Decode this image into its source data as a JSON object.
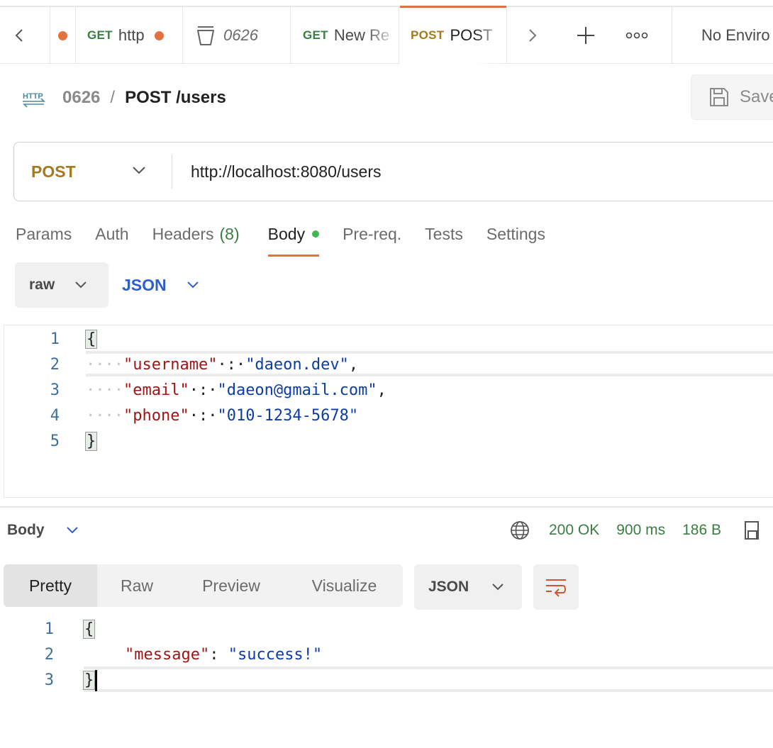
{
  "tabs": [
    {
      "method": "",
      "name": "",
      "dot": true
    },
    {
      "method": "GET",
      "name": "http",
      "dot": true
    },
    {
      "method": "",
      "name": "0626",
      "icon": "collection-icon"
    },
    {
      "method": "GET",
      "name": "New Re"
    },
    {
      "method": "POST",
      "name": "POST",
      "active": true
    }
  ],
  "environment": "No Enviro",
  "breadcrumb": {
    "parent": "0626",
    "separator": "/",
    "title": "POST /users",
    "protocol_icon_text": "HTTP"
  },
  "save_label": "Save",
  "request": {
    "method": "POST",
    "url": "http://localhost:8080/users",
    "tabs": {
      "params": "Params",
      "auth": "Auth",
      "headers": "Headers",
      "headers_count": "(8)",
      "body": "Body",
      "prereq": "Pre-req.",
      "tests": "Tests",
      "settings": "Settings"
    },
    "body_mode": "raw",
    "body_format": "JSON",
    "body_lines": [
      {
        "n": "1",
        "open": "{"
      },
      {
        "n": "2",
        "indent": "····",
        "key": "\"username\"",
        "sep": "·:·",
        "value": "\"daeon.dev\"",
        "tail": ","
      },
      {
        "n": "3",
        "indent": "····",
        "key": "\"email\"",
        "sep": "·:·",
        "value": "\"daeon@gmail.com\"",
        "tail": ","
      },
      {
        "n": "4",
        "indent": "····",
        "key": "\"phone\"",
        "sep": "·:·",
        "value": "\"010-1234-5678\"",
        "tail": ""
      },
      {
        "n": "5",
        "close": "}"
      }
    ]
  },
  "response": {
    "label": "Body",
    "status": "200 OK",
    "time": "900 ms",
    "size": "186 B",
    "views": [
      "Pretty",
      "Raw",
      "Preview",
      "Visualize"
    ],
    "format": "JSON",
    "lines": [
      {
        "n": "1",
        "open": "{"
      },
      {
        "n": "2",
        "key": "\"message\"",
        "sep": ": ",
        "value": "\"success!\""
      },
      {
        "n": "3",
        "close": "}"
      }
    ]
  },
  "colors": {
    "accent": "#e2733f",
    "get": "#3a7d44",
    "post": "#a37a1f",
    "json": "#2f60c9",
    "status_ok": "#3a7d44"
  }
}
